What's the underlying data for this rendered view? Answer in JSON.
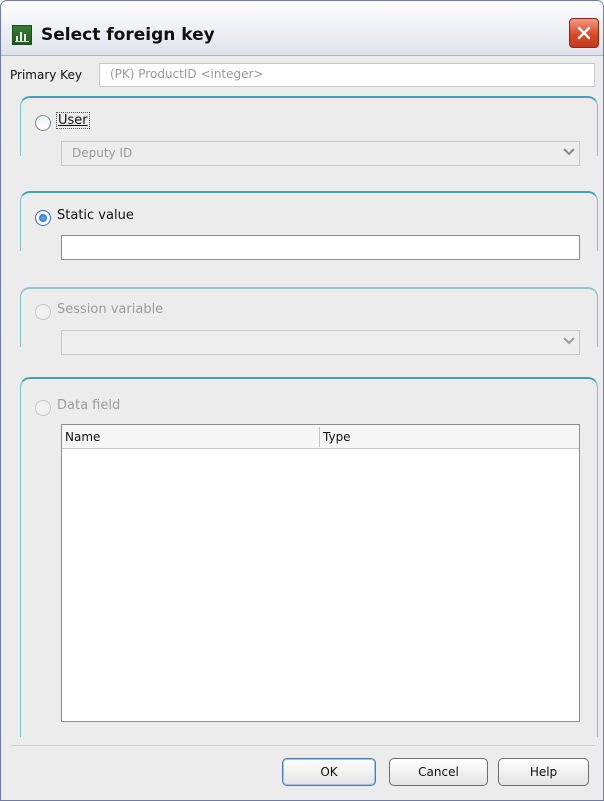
{
  "window": {
    "title": "Select foreign key",
    "app_icon": "database-icon",
    "close_icon": "close-icon"
  },
  "primary_key": {
    "label": "Primary Key",
    "value": "(PK) ProductID <integer>"
  },
  "options": {
    "user": {
      "label": "User",
      "selected_value": "Deputy ID",
      "checked": false
    },
    "static_value": {
      "label": "Static value",
      "value": "",
      "checked": true
    },
    "session_variable": {
      "label": "Session variable",
      "selected_value": "",
      "checked": false,
      "disabled": true
    },
    "data_field": {
      "label": "Data field",
      "checked": false,
      "disabled": true,
      "columns": [
        "Name",
        "Type"
      ],
      "rows": []
    }
  },
  "buttons": {
    "ok": "OK",
    "cancel": "Cancel",
    "help": "Help"
  },
  "colors": {
    "group_accent": "#46a2b2",
    "close_red": "#d94a2c"
  }
}
